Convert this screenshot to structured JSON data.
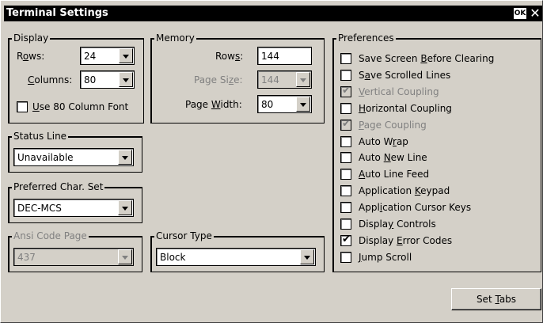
{
  "window": {
    "title": "Terminal Settings",
    "ok_label": "OK",
    "close_label": "✕"
  },
  "display": {
    "legend": "Display",
    "rows_label": [
      "R",
      "o",
      "ws:"
    ],
    "rows_value": "24",
    "columns_label": [
      "",
      "C",
      "olumns:"
    ],
    "columns_value": "80",
    "font80_label": [
      "",
      "U",
      "se 80 Column Font"
    ],
    "font80_checked": false
  },
  "memory": {
    "legend": "Memory",
    "rows_label": [
      "Row",
      "s",
      ":"
    ],
    "rows_value": "144",
    "page_size_label": [
      "Page Si",
      "z",
      "e:"
    ],
    "page_size_value": "144",
    "page_width_label": [
      "Page ",
      "W",
      "idth:"
    ],
    "page_width_value": "80"
  },
  "status_line": {
    "legend": "Status Line",
    "value": "Unavailable"
  },
  "charset": {
    "legend": "Preferred Char. Set",
    "value": "DEC-MCS"
  },
  "ansi": {
    "legend": "Ansi Code Page",
    "value": "437"
  },
  "cursor": {
    "legend": "Cursor Type",
    "value": "Block"
  },
  "preferences": {
    "legend": "Preferences",
    "items": [
      {
        "pre": "Save Screen ",
        "key": "B",
        "post": "efore Clearing",
        "checked": false,
        "disabled": false
      },
      {
        "pre": "S",
        "key": "a",
        "post": "ve Scrolled Lines",
        "checked": false,
        "disabled": false
      },
      {
        "pre": "",
        "key": "V",
        "post": "ertical Coupling",
        "checked": true,
        "disabled": true
      },
      {
        "pre": "",
        "key": "H",
        "post": "orizontal Coupling",
        "checked": false,
        "disabled": false
      },
      {
        "pre": "",
        "key": "P",
        "post": "age Coupling",
        "checked": true,
        "disabled": true
      },
      {
        "pre": "Auto W",
        "key": "r",
        "post": "ap",
        "checked": false,
        "disabled": false
      },
      {
        "pre": "Auto ",
        "key": "N",
        "post": "ew Line",
        "checked": false,
        "disabled": false
      },
      {
        "pre": "",
        "key": "A",
        "post": "uto Line Feed",
        "checked": false,
        "disabled": false
      },
      {
        "pre": "Application ",
        "key": "K",
        "post": "eypad",
        "checked": false,
        "disabled": false
      },
      {
        "pre": "Appl",
        "key": "i",
        "post": "cation Cursor Keys",
        "checked": false,
        "disabled": false
      },
      {
        "pre": "Displa",
        "key": "y",
        "post": " Controls",
        "checked": false,
        "disabled": false
      },
      {
        "pre": "Display ",
        "key": "E",
        "post": "rror Codes",
        "checked": true,
        "disabled": false
      },
      {
        "pre": "",
        "key": "J",
        "post": "ump Scroll",
        "checked": false,
        "disabled": false
      }
    ]
  },
  "set_tabs": {
    "pre": "Set ",
    "key": "T",
    "post": "abs"
  },
  "check_glyph": "✔"
}
